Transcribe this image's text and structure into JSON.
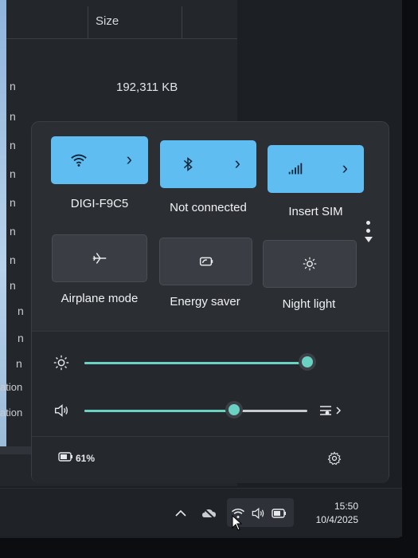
{
  "explorer": {
    "column_header_size": "Size",
    "row_size_value": "192,311 KB",
    "row_suffix": "n",
    "row_partial_1": "ation",
    "row_partial_2": "ation"
  },
  "quick_settings": {
    "tiles": [
      {
        "label": "DIGI-F9C5",
        "icon": "wifi-icon",
        "active": true
      },
      {
        "label": "Not connected",
        "icon": "bluetooth-icon",
        "active": true
      },
      {
        "label": "Insert SIM",
        "icon": "cellular-icon",
        "active": true
      },
      {
        "label": "Airplane mode",
        "icon": "airplane-icon",
        "active": false
      },
      {
        "label": "Energy saver",
        "icon": "energy-saver-icon",
        "active": false
      },
      {
        "label": "Night light",
        "icon": "night-light-icon",
        "active": false
      }
    ],
    "brightness": {
      "icon": "brightness-icon",
      "value": 1.0
    },
    "volume": {
      "icon": "speaker-icon",
      "value": 0.67
    },
    "battery": {
      "icon": "battery-icon",
      "percent_label": "61%"
    }
  },
  "taskbar": {
    "time": "15:50",
    "date": "10/4/2025"
  },
  "colors": {
    "accent": "#60bdf2",
    "slider_accent": "#69d2c3",
    "panel_bg": "#2b2e33"
  }
}
